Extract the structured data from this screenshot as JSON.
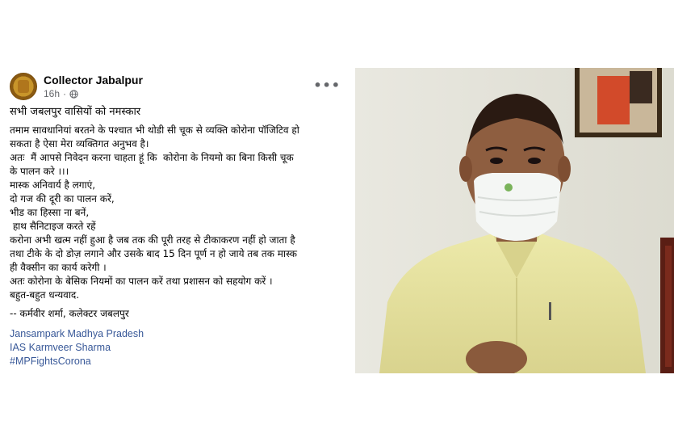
{
  "post": {
    "author": "Collector Jabalpur",
    "time": "16h",
    "greeting": "सभी जबलपुर वासियों को नमस्कार",
    "lines": [
      "तमाम सावधानियां बरतने के पश्चात भी थोडी सी चूक से व्यक्ति कोरोना पॉजिटिव हो",
      "सकता है ऐसा मेरा व्यक्तिगत अनुभव है।",
      "अतः  मैं आपसे निवेदन करना चाहता हूं कि  कोरोना के नियमो का बिना किसी चूक",
      "के पालन करे ।।।",
      "मास्क अनिवार्य है लगाएं,",
      "दो गज की दूरी का पालन करें,",
      "भीड का हिस्सा ना बनें,",
      " हाथ सैनिटाइज करते रहें",
      "करोना अभी खत्म नहीं हुआ है जब तक की पूरी तरह से टीकाकरण नहीं हो जाता है",
      "तथा टीके के दो डोज़ लगाने और उसके बाद 15 दिन पूर्ण न हो जाये तब तक मास्क",
      "ही वैक्सीन का कार्य करेगी ।",
      "अतः कोरोना के बेसिक नियमों का पालन करें तथा प्रशासन को सहयोग करें ।",
      "बहुत-बहुत धन्यवाद."
    ],
    "signature": "-- कर्मवीर शर्मा, कलेक्टर जबलपुर",
    "tags": [
      "Jansampark Madhya Pradesh",
      "IAS Karmveer Sharma",
      "#MPFightsCorona"
    ]
  },
  "icons": {
    "avatar": "district-emblem-icon",
    "privacy": "globe-icon",
    "menu": "more-options-icon"
  },
  "colors": {
    "link": "#385898",
    "muted": "#65676b",
    "text": "#050505"
  }
}
